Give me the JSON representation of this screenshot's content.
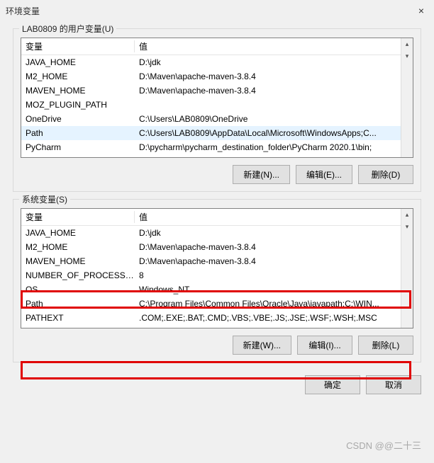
{
  "window": {
    "title": "环境变量",
    "close": "×"
  },
  "userSection": {
    "label": "LAB0809 的用户变量(U)",
    "headers": {
      "var": "变量",
      "val": "值"
    },
    "rows": [
      {
        "var": "JAVA_HOME",
        "val": "D:\\jdk"
      },
      {
        "var": "M2_HOME",
        "val": "D:\\Maven\\apache-maven-3.8.4"
      },
      {
        "var": "MAVEN_HOME",
        "val": "D:\\Maven\\apache-maven-3.8.4"
      },
      {
        "var": "MOZ_PLUGIN_PATH",
        "val": ""
      },
      {
        "var": "OneDrive",
        "val": "C:\\Users\\LAB0809\\OneDrive"
      },
      {
        "var": "Path",
        "val": "C:\\Users\\LAB0809\\AppData\\Local\\Microsoft\\WindowsApps;C..."
      },
      {
        "var": "PyCharm",
        "val": "D:\\pycharm\\pycharm_destination_folder\\PyCharm 2020.1\\bin;"
      }
    ],
    "buttons": {
      "new": "新建(N)...",
      "edit": "编辑(E)...",
      "delete": "删除(D)"
    }
  },
  "sysSection": {
    "label": "系统变量(S)",
    "headers": {
      "var": "变量",
      "val": "值"
    },
    "rows": [
      {
        "var": "JAVA_HOME",
        "val": "D:\\jdk"
      },
      {
        "var": "M2_HOME",
        "val": "D:\\Maven\\apache-maven-3.8.4"
      },
      {
        "var": "MAVEN_HOME",
        "val": "D:\\Maven\\apache-maven-3.8.4"
      },
      {
        "var": "NUMBER_OF_PROCESSORS",
        "val": "8"
      },
      {
        "var": "OS",
        "val": "Windows_NT"
      },
      {
        "var": "Path",
        "val": "C:\\Program Files\\Common Files\\Oracle\\Java\\javapath;C:\\WIN..."
      },
      {
        "var": "PATHEXT",
        "val": ".COM;.EXE;.BAT;.CMD;.VBS;.VBE;.JS;.JSE;.WSF;.WSH;.MSC"
      }
    ],
    "buttons": {
      "new": "新建(W)...",
      "edit": "编辑(I)...",
      "delete": "删除(L)"
    }
  },
  "footer": {
    "ok": "确定",
    "cancel": "取消"
  },
  "watermark": "CSDN @@二十三"
}
